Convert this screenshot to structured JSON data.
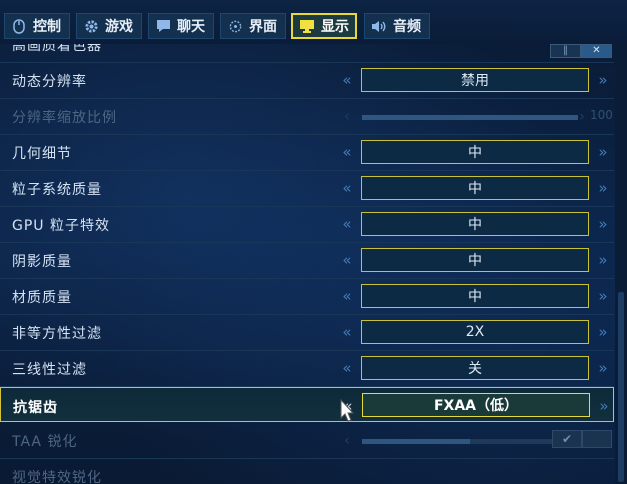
{
  "tabs": [
    {
      "label": "控制",
      "icon": "mouse-icon"
    },
    {
      "label": "游戏",
      "icon": "gear-icon"
    },
    {
      "label": "聊天",
      "icon": "chat-icon"
    },
    {
      "label": "界面",
      "icon": "crosshair-icon"
    },
    {
      "label": "显示",
      "icon": "monitor-icon",
      "active": true
    },
    {
      "label": "音频",
      "icon": "speaker-icon"
    }
  ],
  "top_row": {
    "label": "高画质着色器"
  },
  "rows": [
    {
      "label": "动态分辨率",
      "value": "禁用"
    },
    {
      "label": "分辨率缩放比例",
      "slider_value": "100",
      "dim": true
    },
    {
      "label": "几何细节",
      "value": "中"
    },
    {
      "label": "粒子系统质量",
      "value": "中"
    },
    {
      "label": "GPU 粒子特效",
      "value": "中"
    },
    {
      "label": "阴影质量",
      "value": "中"
    },
    {
      "label": "材质质量",
      "value": "中"
    },
    {
      "label": "非等方性过滤",
      "value": "2X"
    },
    {
      "label": "三线性过滤",
      "value": "关"
    },
    {
      "label": "抗锯齿",
      "value": "FXAA（低）",
      "highlight": true
    },
    {
      "label": "TAA 锐化",
      "slider_value": "50",
      "dim": true
    },
    {
      "label": "视觉特效锐化"
    }
  ],
  "colors": {
    "accent": "#e8d838",
    "background": "#0a1b35",
    "arrow": "#3f7bb8"
  }
}
